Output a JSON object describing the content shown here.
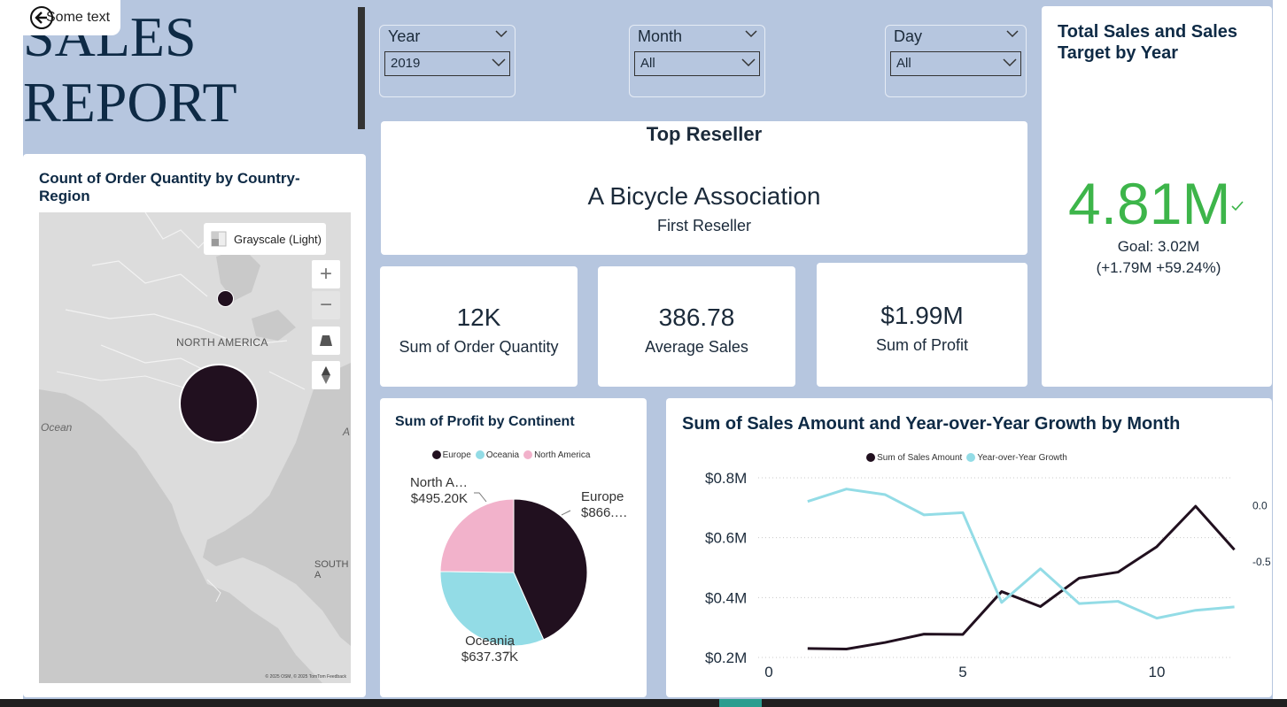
{
  "header": {
    "title_line1": "SALES",
    "title_line2": "REPORT",
    "back_button_label": "Some text"
  },
  "slicers": [
    {
      "label": "Year",
      "value": "2019"
    },
    {
      "label": "Month",
      "value": "All"
    },
    {
      "label": "Day",
      "value": "All"
    }
  ],
  "top_reseller": {
    "title": "Top Reseller",
    "name": "A Bicycle Association",
    "subtitle": "First Reseller"
  },
  "kpis": [
    {
      "value": "12K",
      "label": "Sum of Order Quantity"
    },
    {
      "value": "386.78",
      "label": "Average Sales"
    },
    {
      "value": "$1.99M",
      "label": "Sum of Profit"
    }
  ],
  "sales_target": {
    "title": "Total Sales and Sales Target by Year",
    "value": "4.81M",
    "goal": "Goal: 3.02M",
    "delta": "(+1.79M +59.24%)",
    "value_color": "#3db54a"
  },
  "map_card": {
    "title": "Count of Order Quantity by Country-Region",
    "style_button": "Grayscale (Light)",
    "labels": {
      "north_america": "NORTH AMERICA",
      "south_america": "SOUTH A",
      "ocean": "Ocean",
      "right_edge": "A"
    },
    "attribution": "© 2025 OSM, © 2025 TomTom Feedback",
    "controls": {
      "zoom_in": "+",
      "zoom_out": "−"
    }
  },
  "chart_data": [
    {
      "type": "pie",
      "title": "Sum of Profit by Continent",
      "legend": "top",
      "slices": [
        {
          "name": "Europe",
          "value": 866000,
          "label_name": "Europe",
          "label_value": "$866.…",
          "color": "#21101f"
        },
        {
          "name": "Oceania",
          "value": 637370,
          "label_name": "Oceania",
          "label_value": "$637.37K",
          "color": "#93dce6"
        },
        {
          "name": "North America",
          "value": 495200,
          "label_name": "North A…",
          "label_value": "$495.20K",
          "color": "#f2b2cb"
        }
      ]
    },
    {
      "type": "line",
      "title": "Sum of Sales Amount and Year-over-Year Growth by Month",
      "legend": "top",
      "x_ticks": [
        0,
        5,
        10
      ],
      "xlim": [
        0,
        12.5
      ],
      "y_left_ticks": [
        "$0.8M",
        "$0.6M",
        "$0.4M",
        "$0.2M"
      ],
      "y_left_tick_values": [
        0.8,
        0.6,
        0.4,
        0.2
      ],
      "ylim_left": [
        0.2,
        0.8
      ],
      "y_right_ticks": [
        "0.0",
        "-0.5"
      ],
      "y_right_tick_values": [
        0.0,
        -0.5
      ],
      "ylim_right": [
        -1.35,
        0.25
      ],
      "grid": true,
      "series": [
        {
          "name": "Sum of Sales Amount",
          "axis": "left",
          "color": "#21101f",
          "x": [
            1,
            2,
            3,
            4,
            5,
            6,
            7,
            8,
            9,
            10,
            11,
            12
          ],
          "values": [
            0.23,
            0.228,
            0.25,
            0.278,
            0.277,
            0.42,
            0.37,
            0.465,
            0.485,
            0.57,
            0.705,
            0.56
          ]
        },
        {
          "name": "Year-over-Year Growth",
          "axis": "right",
          "color": "#93dce6",
          "x": [
            1,
            2,
            3,
            4,
            5,
            6,
            7,
            8,
            9,
            10,
            11,
            12
          ],
          "values": [
            0.04,
            0.15,
            0.1,
            -0.08,
            -0.06,
            -0.86,
            -0.56,
            -0.87,
            -0.85,
            -1.0,
            -0.93,
            -0.9
          ]
        }
      ]
    }
  ]
}
